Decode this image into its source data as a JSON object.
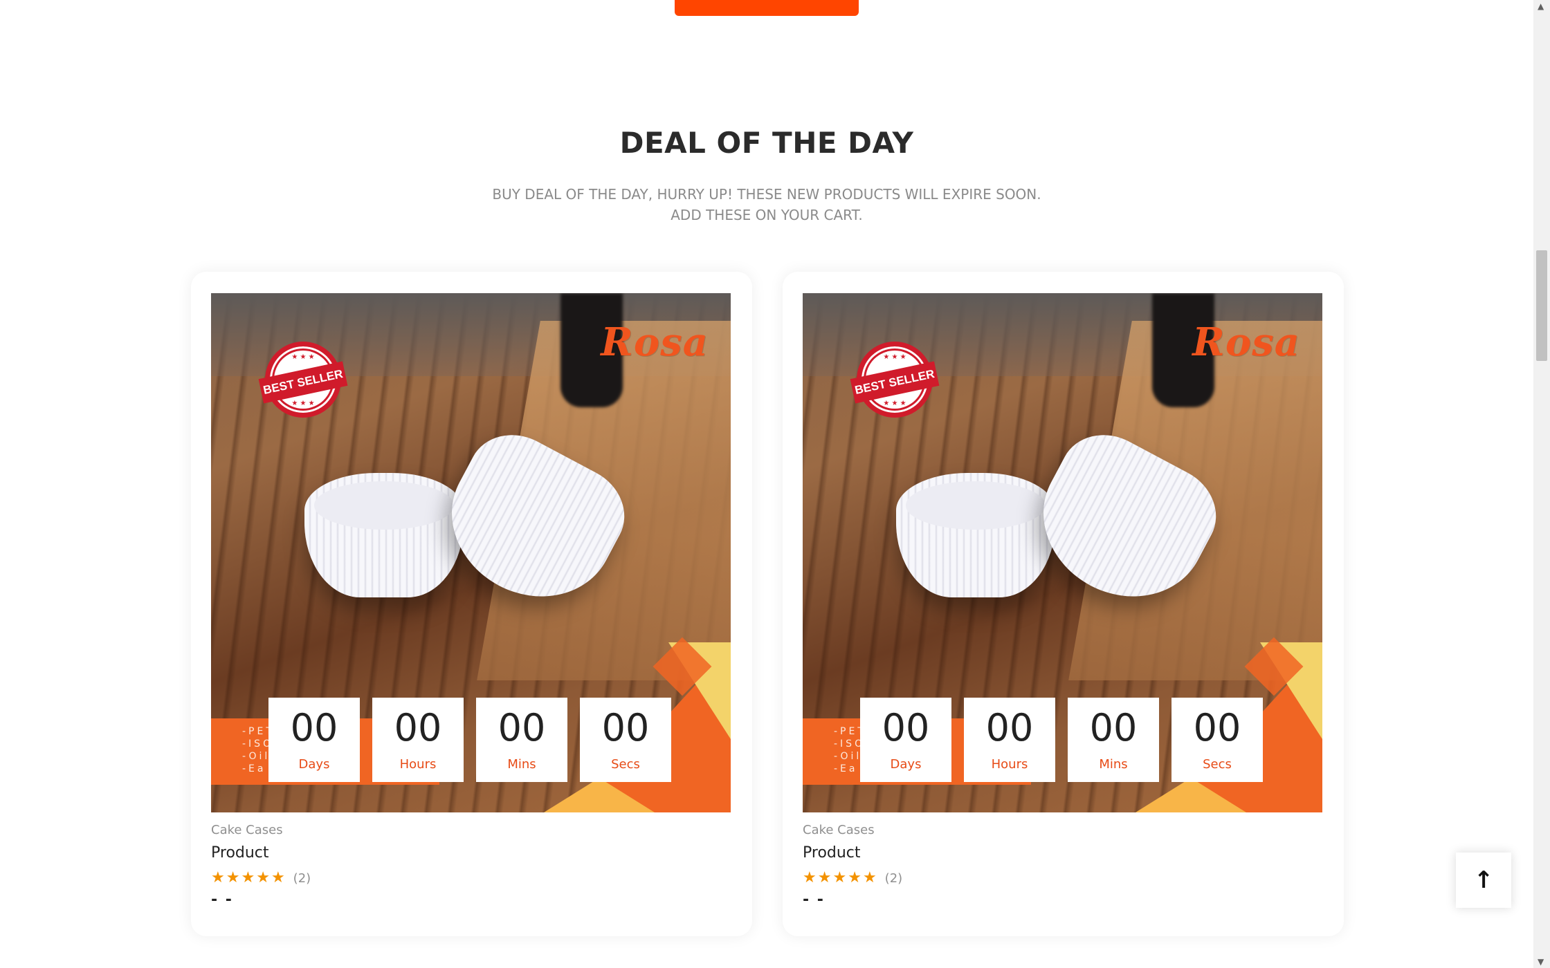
{
  "section": {
    "title": "DEAL OF THE DAY",
    "subtitle_line1": "BUY DEAL OF THE DAY, HURRY UP! THESE NEW PRODUCTS WILL EXPIRE SOON.",
    "subtitle_line2": "ADD THESE ON YOUR CART."
  },
  "products": [
    {
      "image_logo": "Rosa",
      "image_badge": "BEST SELLER",
      "image_strip_lines": [
        "-PET",
        "-ISO",
        "-Oil",
        "-Ea"
      ],
      "countdown": {
        "days": "00",
        "days_label": "Days",
        "hours": "00",
        "hours_label": "Hours",
        "mins": "00",
        "mins_label": "Mins",
        "secs": "00",
        "secs_label": "Secs"
      },
      "category": "Cake Cases",
      "name": "Product",
      "rating_stars": 5,
      "rating_count": "(2)",
      "price": "-   -"
    },
    {
      "image_logo": "Rosa",
      "image_badge": "BEST SELLER",
      "image_strip_lines": [
        "-PET",
        "-ISO",
        "-Oil",
        "-Ea"
      ],
      "countdown": {
        "days": "00",
        "days_label": "Days",
        "hours": "00",
        "hours_label": "Hours",
        "mins": "00",
        "mins_label": "Mins",
        "secs": "00",
        "secs_label": "Secs"
      },
      "category": "Cake Cases",
      "name": "Product",
      "rating_stars": 5,
      "rating_count": "(2)",
      "price": "-   -"
    }
  ],
  "back_to_top": "↑",
  "icons": {
    "star": "star-icon",
    "back_to_top": "arrow-up-icon"
  },
  "colors": {
    "accent": "#ff4500",
    "countdown_label": "#e74b16",
    "star": "#f39200"
  }
}
